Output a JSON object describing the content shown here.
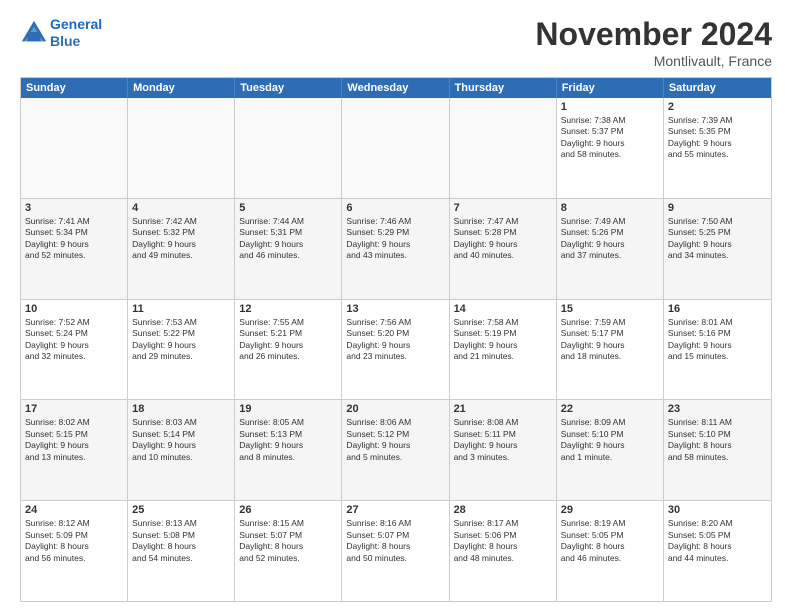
{
  "header": {
    "logo_line1": "General",
    "logo_line2": "Blue",
    "month": "November 2024",
    "location": "Montlivault, France"
  },
  "days_of_week": [
    "Sunday",
    "Monday",
    "Tuesday",
    "Wednesday",
    "Thursday",
    "Friday",
    "Saturday"
  ],
  "weeks": [
    [
      {
        "day": "",
        "info": ""
      },
      {
        "day": "",
        "info": ""
      },
      {
        "day": "",
        "info": ""
      },
      {
        "day": "",
        "info": ""
      },
      {
        "day": "",
        "info": ""
      },
      {
        "day": "1",
        "info": "Sunrise: 7:38 AM\nSunset: 5:37 PM\nDaylight: 9 hours\nand 58 minutes."
      },
      {
        "day": "2",
        "info": "Sunrise: 7:39 AM\nSunset: 5:35 PM\nDaylight: 9 hours\nand 55 minutes."
      }
    ],
    [
      {
        "day": "3",
        "info": "Sunrise: 7:41 AM\nSunset: 5:34 PM\nDaylight: 9 hours\nand 52 minutes."
      },
      {
        "day": "4",
        "info": "Sunrise: 7:42 AM\nSunset: 5:32 PM\nDaylight: 9 hours\nand 49 minutes."
      },
      {
        "day": "5",
        "info": "Sunrise: 7:44 AM\nSunset: 5:31 PM\nDaylight: 9 hours\nand 46 minutes."
      },
      {
        "day": "6",
        "info": "Sunrise: 7:46 AM\nSunset: 5:29 PM\nDaylight: 9 hours\nand 43 minutes."
      },
      {
        "day": "7",
        "info": "Sunrise: 7:47 AM\nSunset: 5:28 PM\nDaylight: 9 hours\nand 40 minutes."
      },
      {
        "day": "8",
        "info": "Sunrise: 7:49 AM\nSunset: 5:26 PM\nDaylight: 9 hours\nand 37 minutes."
      },
      {
        "day": "9",
        "info": "Sunrise: 7:50 AM\nSunset: 5:25 PM\nDaylight: 9 hours\nand 34 minutes."
      }
    ],
    [
      {
        "day": "10",
        "info": "Sunrise: 7:52 AM\nSunset: 5:24 PM\nDaylight: 9 hours\nand 32 minutes."
      },
      {
        "day": "11",
        "info": "Sunrise: 7:53 AM\nSunset: 5:22 PM\nDaylight: 9 hours\nand 29 minutes."
      },
      {
        "day": "12",
        "info": "Sunrise: 7:55 AM\nSunset: 5:21 PM\nDaylight: 9 hours\nand 26 minutes."
      },
      {
        "day": "13",
        "info": "Sunrise: 7:56 AM\nSunset: 5:20 PM\nDaylight: 9 hours\nand 23 minutes."
      },
      {
        "day": "14",
        "info": "Sunrise: 7:58 AM\nSunset: 5:19 PM\nDaylight: 9 hours\nand 21 minutes."
      },
      {
        "day": "15",
        "info": "Sunrise: 7:59 AM\nSunset: 5:17 PM\nDaylight: 9 hours\nand 18 minutes."
      },
      {
        "day": "16",
        "info": "Sunrise: 8:01 AM\nSunset: 5:16 PM\nDaylight: 9 hours\nand 15 minutes."
      }
    ],
    [
      {
        "day": "17",
        "info": "Sunrise: 8:02 AM\nSunset: 5:15 PM\nDaylight: 9 hours\nand 13 minutes."
      },
      {
        "day": "18",
        "info": "Sunrise: 8:03 AM\nSunset: 5:14 PM\nDaylight: 9 hours\nand 10 minutes."
      },
      {
        "day": "19",
        "info": "Sunrise: 8:05 AM\nSunset: 5:13 PM\nDaylight: 9 hours\nand 8 minutes."
      },
      {
        "day": "20",
        "info": "Sunrise: 8:06 AM\nSunset: 5:12 PM\nDaylight: 9 hours\nand 5 minutes."
      },
      {
        "day": "21",
        "info": "Sunrise: 8:08 AM\nSunset: 5:11 PM\nDaylight: 9 hours\nand 3 minutes."
      },
      {
        "day": "22",
        "info": "Sunrise: 8:09 AM\nSunset: 5:10 PM\nDaylight: 9 hours\nand 1 minute."
      },
      {
        "day": "23",
        "info": "Sunrise: 8:11 AM\nSunset: 5:10 PM\nDaylight: 8 hours\nand 58 minutes."
      }
    ],
    [
      {
        "day": "24",
        "info": "Sunrise: 8:12 AM\nSunset: 5:09 PM\nDaylight: 8 hours\nand 56 minutes."
      },
      {
        "day": "25",
        "info": "Sunrise: 8:13 AM\nSunset: 5:08 PM\nDaylight: 8 hours\nand 54 minutes."
      },
      {
        "day": "26",
        "info": "Sunrise: 8:15 AM\nSunset: 5:07 PM\nDaylight: 8 hours\nand 52 minutes."
      },
      {
        "day": "27",
        "info": "Sunrise: 8:16 AM\nSunset: 5:07 PM\nDaylight: 8 hours\nand 50 minutes."
      },
      {
        "day": "28",
        "info": "Sunrise: 8:17 AM\nSunset: 5:06 PM\nDaylight: 8 hours\nand 48 minutes."
      },
      {
        "day": "29",
        "info": "Sunrise: 8:19 AM\nSunset: 5:05 PM\nDaylight: 8 hours\nand 46 minutes."
      },
      {
        "day": "30",
        "info": "Sunrise: 8:20 AM\nSunset: 5:05 PM\nDaylight: 8 hours\nand 44 minutes."
      }
    ]
  ]
}
